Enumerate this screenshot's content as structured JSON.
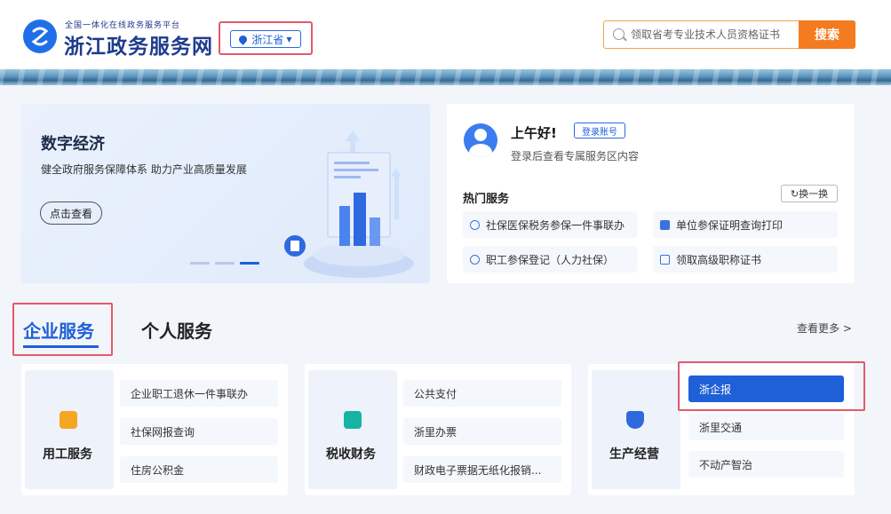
{
  "header": {
    "site_subtitle": "全国一体化在线政务服务平台",
    "site_title": "浙江政务服务网",
    "region": "浙江省",
    "search_placeholder": "领取省考专业技术人员资格证书",
    "search_button": "搜索"
  },
  "promo": {
    "title": "数字经济",
    "subtitle": "健全政府服务保障体系 助力产业高质量发展",
    "button": "点击查看",
    "slide_count": 3,
    "active_slide": 3
  },
  "user_panel": {
    "greeting": "上午好!",
    "login_button": "登录账号",
    "hint": "登录后查看专属服务区内容",
    "hot_title": "热门服务",
    "refresh_button": "换一换",
    "services": [
      "社保医保税务参保一件事联办",
      "单位参保证明查询打印",
      "职工参保登记（人力社保）",
      "领取高级职称证书"
    ]
  },
  "tabs": {
    "enterprise": "企业服务",
    "personal": "个人服务",
    "more": "查看更多 >"
  },
  "categories": [
    {
      "name": "用工服务",
      "items": [
        "企业职工退休一件事联办",
        "社保网报查询",
        "住房公积金"
      ]
    },
    {
      "name": "税收财务",
      "items": [
        "公共支付",
        "浙里办票",
        "财政电子票据无纸化报销..."
      ]
    },
    {
      "name": "生产经营",
      "items": [
        "浙企报",
        "浙里交通",
        "不动产智治"
      ]
    }
  ],
  "colors": {
    "primary": "#1f5fd8",
    "accent": "#f47b20",
    "highlight": "#e35a6c"
  }
}
